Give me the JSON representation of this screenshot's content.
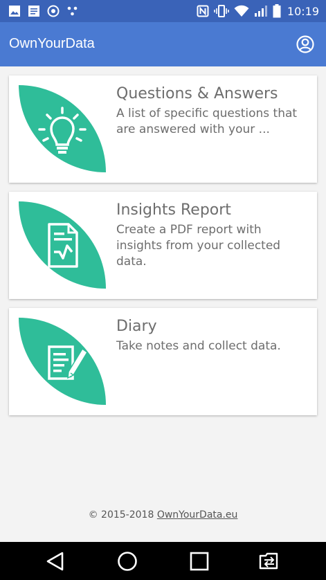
{
  "status_bar": {
    "time": "10:19",
    "left_icons": [
      "image-icon",
      "document-icon",
      "sync-icon",
      "dots-icon"
    ],
    "right_icons": [
      "nfc-icon",
      "vibrate-icon",
      "wifi-icon",
      "signal-icon",
      "battery-icon"
    ]
  },
  "app_bar": {
    "title": "OwnYourData",
    "account_icon": "account-circle-icon"
  },
  "cards": [
    {
      "icon": "lightbulb-icon",
      "title": "Questions & Answers",
      "description": "A list of specific questions that are answered with your ..."
    },
    {
      "icon": "report-icon",
      "title": "Insights Report",
      "description": "Create a PDF report with insights from your collected data."
    },
    {
      "icon": "edit-note-icon",
      "title": "Diary",
      "description": "Take notes and collect data."
    }
  ],
  "footer": {
    "copyright": "© 2015-2018",
    "link_text": "OwnYourData.eu"
  },
  "nav_bar": {
    "icons": [
      "back-icon",
      "home-icon",
      "recent-apps-icon",
      "switch-sim-icon"
    ]
  },
  "colors": {
    "status_bar": "#3a63b8",
    "app_bar": "#4a7ad2",
    "accent_green": "#2fbd99",
    "background": "#f3f3f3"
  }
}
